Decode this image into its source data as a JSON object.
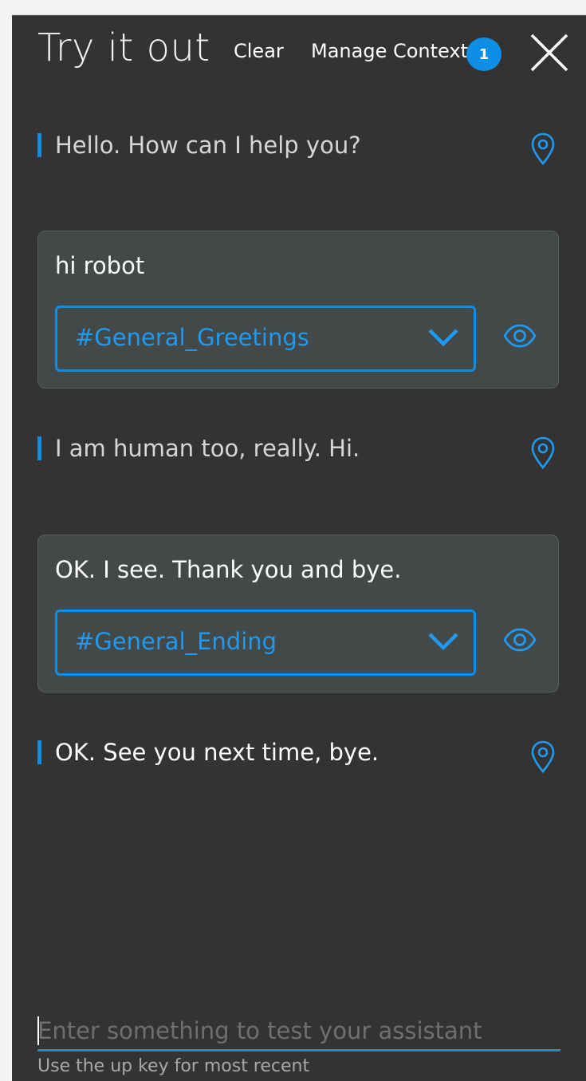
{
  "header": {
    "title": "Try it out",
    "clear_label": "Clear",
    "manage_context_label": "Manage Context",
    "context_count": "1"
  },
  "conversation": [
    {
      "type": "bot",
      "text": "Hello. How can I help you?"
    },
    {
      "type": "user",
      "text": "hi robot",
      "intent": "#General_Greetings"
    },
    {
      "type": "bot",
      "text": "I am human too, really. Hi."
    },
    {
      "type": "user",
      "text": "OK. I see. Thank you and bye.",
      "intent": "#General_Ending"
    },
    {
      "type": "bot",
      "text": "OK. See you next time, bye."
    }
  ],
  "composer": {
    "value": "",
    "placeholder": "Enter something to test your assistant",
    "hint": "Use the up key for most recent"
  },
  "colors": {
    "accent": "#0f8ee6",
    "panel_bg": "#333333",
    "card_bg": "#434849"
  },
  "icons": {
    "close": "close-icon",
    "jump": "location-pin-icon",
    "view": "eye-icon",
    "dropdown": "chevron-down-icon"
  }
}
